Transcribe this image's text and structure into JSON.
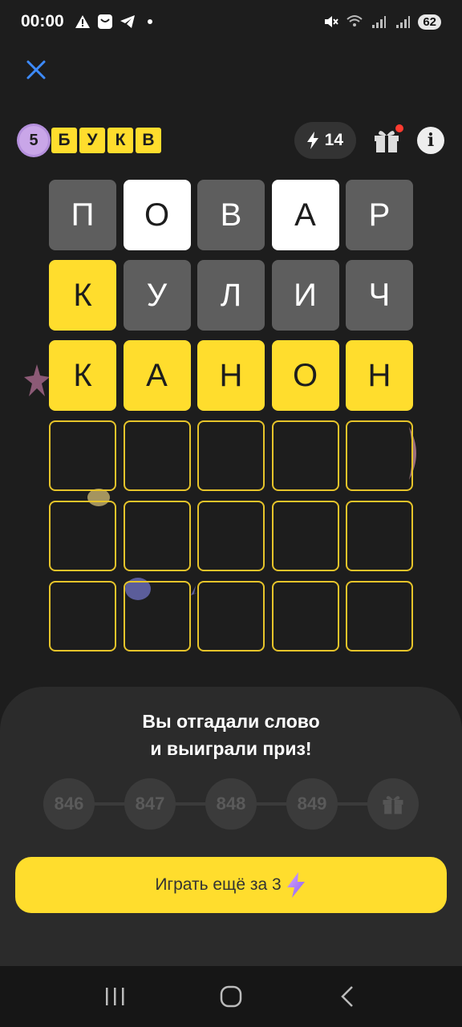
{
  "status_bar": {
    "time": "00:00",
    "battery": "62",
    "icons": [
      "warning-icon",
      "app-notification-icon",
      "telegram-icon",
      "dot-icon",
      "mute-icon",
      "wifi-icon",
      "signal-icon",
      "signal-icon"
    ]
  },
  "header": {
    "logo_number": "5",
    "logo_letters": [
      "Б",
      "У",
      "К",
      "В"
    ],
    "energy_count": "14"
  },
  "grid": {
    "rows": [
      [
        {
          "l": "П",
          "s": "gray"
        },
        {
          "l": "О",
          "s": "white"
        },
        {
          "l": "В",
          "s": "gray"
        },
        {
          "l": "А",
          "s": "white"
        },
        {
          "l": "Р",
          "s": "gray"
        }
      ],
      [
        {
          "l": "К",
          "s": "yellow"
        },
        {
          "l": "У",
          "s": "gray"
        },
        {
          "l": "Л",
          "s": "gray"
        },
        {
          "l": "И",
          "s": "gray"
        },
        {
          "l": "Ч",
          "s": "gray"
        }
      ],
      [
        {
          "l": "К",
          "s": "yellow"
        },
        {
          "l": "А",
          "s": "yellow"
        },
        {
          "l": "Н",
          "s": "yellow"
        },
        {
          "l": "О",
          "s": "yellow"
        },
        {
          "l": "Н",
          "s": "yellow"
        }
      ],
      [
        {
          "l": "",
          "s": "empty"
        },
        {
          "l": "",
          "s": "empty"
        },
        {
          "l": "",
          "s": "empty"
        },
        {
          "l": "",
          "s": "empty"
        },
        {
          "l": "",
          "s": "empty"
        }
      ],
      [
        {
          "l": "",
          "s": "empty"
        },
        {
          "l": "",
          "s": "empty"
        },
        {
          "l": "",
          "s": "empty"
        },
        {
          "l": "",
          "s": "empty"
        },
        {
          "l": "",
          "s": "empty"
        }
      ],
      [
        {
          "l": "",
          "s": "empty"
        },
        {
          "l": "",
          "s": "empty"
        },
        {
          "l": "",
          "s": "empty"
        },
        {
          "l": "",
          "s": "empty"
        },
        {
          "l": "",
          "s": "empty"
        }
      ]
    ]
  },
  "result": {
    "line1": "Вы отгадали слово",
    "line2": "и выиграли приз!",
    "progress_steps": [
      "846",
      "847",
      "848",
      "849"
    ],
    "play_again_label": "Играть ещё за 3"
  },
  "colors": {
    "accent_yellow": "#ffdd2d",
    "tile_gray": "#5e5e5e",
    "background": "#1d1d1d",
    "panel": "#2b2b2b"
  }
}
